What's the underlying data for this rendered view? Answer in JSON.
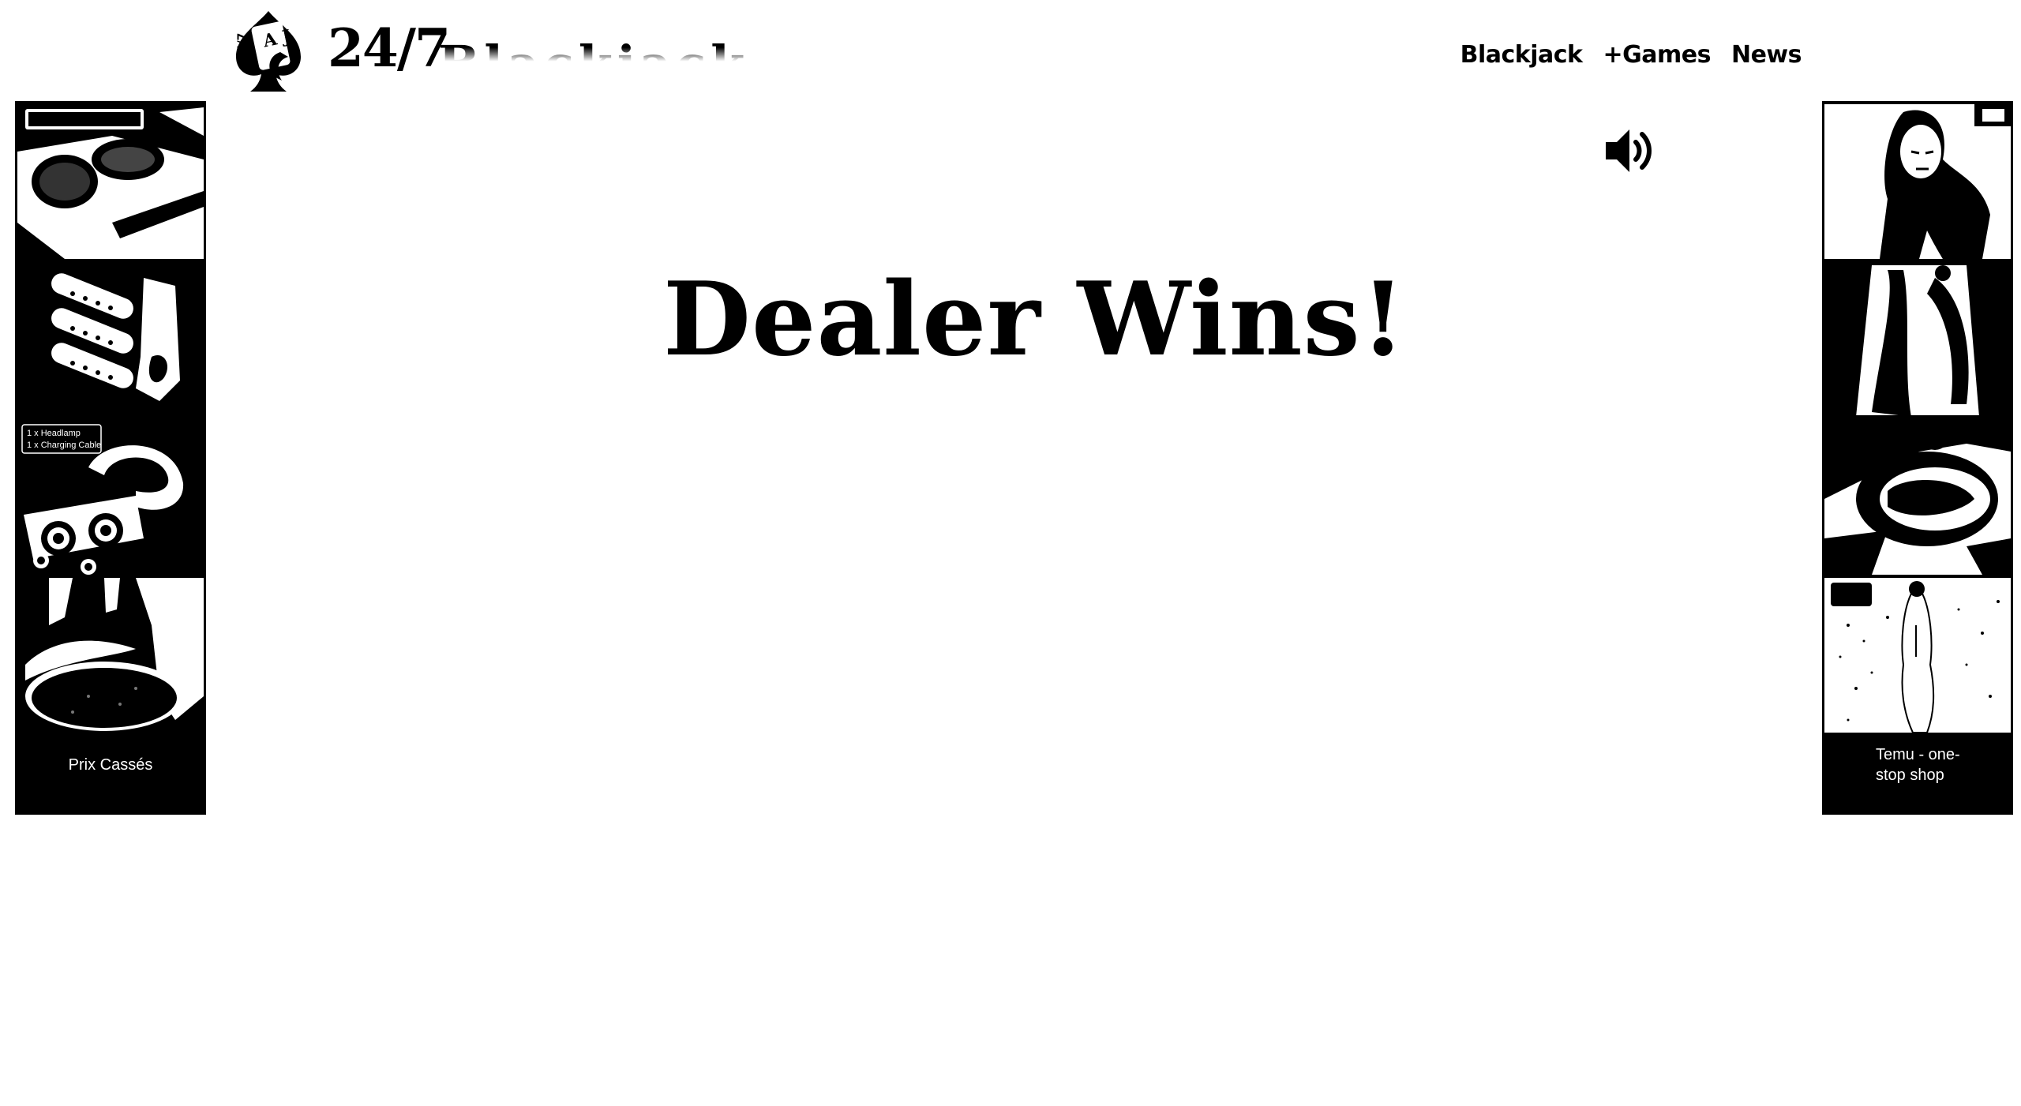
{
  "header": {
    "logo_text": "24/7",
    "logo_subtitle": "Blackjack",
    "logo_icon_letters": {
      "side": "24/7",
      "card": "A J"
    }
  },
  "nav": {
    "items": [
      {
        "label": "Blackjack"
      },
      {
        "label": "+Games"
      },
      {
        "label": "News"
      }
    ]
  },
  "ads": {
    "left": {
      "caption": "Prix Cassés",
      "tiles": [
        {
          "icon": "sink-product-image"
        },
        {
          "icon": "guitar-pickguard-product-image"
        },
        {
          "icon": "headlamp-product-image",
          "overlay_lines": [
            "1 x Headlamp",
            "1 x Charging Cable"
          ]
        },
        {
          "icon": "cookware-product-image"
        }
      ]
    },
    "right": {
      "caption": "Temu - one-stop shop",
      "tiles": [
        {
          "icon": "woman-portrait-image"
        },
        {
          "icon": "dress-product-image"
        },
        {
          "icon": "bag-product-image"
        },
        {
          "icon": "outfit-product-image"
        }
      ]
    }
  },
  "sound": {
    "icon": "speaker-volume-icon"
  },
  "game": {
    "result_message": "Dealer Wins!"
  },
  "colors": {
    "text": "#000000",
    "background": "#ffffff",
    "ad_background": "#000000",
    "ad_text": "#ffffff"
  }
}
